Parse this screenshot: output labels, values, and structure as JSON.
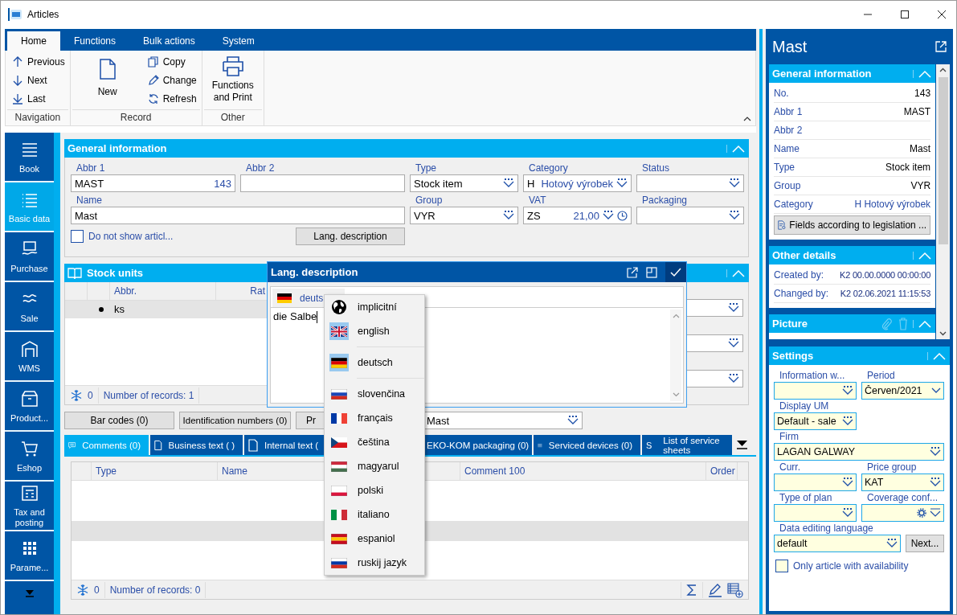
{
  "window": {
    "title": "Articles"
  },
  "ribbon": {
    "tabs": [
      {
        "label": "Home",
        "selected": true
      },
      {
        "label": "Functions",
        "selected": false
      },
      {
        "label": "Bulk actions",
        "selected": false
      },
      {
        "label": "System",
        "selected": false
      }
    ],
    "groups": [
      {
        "label": "Navigation",
        "buttons": [
          {
            "label": "Previous",
            "kind": "small"
          },
          {
            "label": "Next",
            "kind": "small"
          },
          {
            "label": "Last",
            "kind": "small"
          }
        ]
      },
      {
        "label": "Record",
        "buttons": [
          {
            "label": "New",
            "kind": "large"
          },
          {
            "label": "Copy",
            "kind": "small"
          },
          {
            "label": "Change",
            "kind": "small"
          },
          {
            "label": "Refresh",
            "kind": "small"
          }
        ]
      },
      {
        "label": "Other",
        "buttons": [
          {
            "label": "Functions and Print",
            "kind": "large"
          }
        ]
      }
    ]
  },
  "nav": [
    {
      "label": "Book",
      "selected": false
    },
    {
      "label": "Basic data",
      "selected": true
    },
    {
      "label": "Purchase",
      "selected": false
    },
    {
      "label": "Sale",
      "selected": false
    },
    {
      "label": "WMS",
      "selected": false
    },
    {
      "label": "Product...",
      "selected": false
    },
    {
      "label": "Eshop",
      "selected": false
    },
    {
      "label": "Tax and posting",
      "selected": false
    },
    {
      "label": "Parame...",
      "selected": false
    }
  ],
  "general": {
    "title": "General information",
    "fields": [
      {
        "label": "Abbr 1",
        "value": "MAST",
        "suffix": "143",
        "kind": "text"
      },
      {
        "label": "Abbr 2",
        "kind": "text"
      },
      {
        "label": "Type",
        "value": "Stock item",
        "kind": "lookup"
      },
      {
        "label": "Category",
        "value": "H",
        "suffix": "Hotový výrobek",
        "kind": "lookup"
      },
      {
        "label": "Status",
        "kind": "lookup"
      },
      {
        "label": "Name",
        "value": "Mast",
        "kind": "text"
      },
      {
        "label": "Group",
        "value": "VYR",
        "kind": "lookup"
      },
      {
        "label": "VAT",
        "value": "ZS",
        "suffix": "21,00",
        "kind": "lookup-clock"
      },
      {
        "label": "Packaging",
        "kind": "lookup"
      }
    ],
    "checkbox": {
      "label": "Do not show articl...",
      "checked": false
    },
    "button": "Lang. description"
  },
  "stock": {
    "title": "Stock units",
    "columns": [
      "Abbr.",
      "Rat"
    ],
    "rows": [
      {
        "current": true,
        "selected": true,
        "cells": [
          "ks"
        ]
      }
    ],
    "footer": {
      "count": "0",
      "records": "Number of records: 1"
    }
  },
  "actions": {
    "buttons": [
      "Bar codes (0)",
      "Identification numbers (0)",
      "Pr"
    ],
    "field": "Mast"
  },
  "tabs": [
    {
      "label": "Comments (0)",
      "selected": true
    },
    {
      "label": "Business text ( )",
      "selected": false
    },
    {
      "label": "Internal text (",
      "selected": false
    },
    {
      "label": "EKO-KOM packaging (0)",
      "selected": false
    },
    {
      "label": "Serviced devices (0)",
      "selected": false
    },
    {
      "label": "List of service sheets",
      "badge": "S",
      "selected": false
    }
  ],
  "comments": {
    "columns": [
      "Type",
      "Name",
      "Comment 100",
      "Order"
    ],
    "rows": [
      {
        "selected": false
      },
      {
        "selected": false
      },
      {
        "selected": true
      }
    ],
    "footer": {
      "count": "0",
      "records": "Number of records: 0"
    }
  },
  "popup": {
    "title": "Lang. description",
    "language": "deuts",
    "text": "die Salbe"
  },
  "language_menu": [
    {
      "label": "implicitní",
      "highlighted": false,
      "separator_after": false
    },
    {
      "label": "english",
      "highlighted": true,
      "separator_after": true
    },
    {
      "label": "deutsch",
      "highlighted": true,
      "separator_after": true
    },
    {
      "label": "slovenčina",
      "highlighted": false,
      "separator_after": false
    },
    {
      "label": "français",
      "highlighted": false,
      "separator_after": false
    },
    {
      "label": "čeština",
      "highlighted": false,
      "separator_after": false
    },
    {
      "label": "magyarul",
      "highlighted": false,
      "separator_after": false
    },
    {
      "label": "polski",
      "highlighted": false,
      "separator_after": false
    },
    {
      "label": "italiano",
      "highlighted": false,
      "separator_after": false
    },
    {
      "label": "espaniol",
      "highlighted": false,
      "separator_after": false
    },
    {
      "label": "ruskij jazyk",
      "highlighted": false,
      "separator_after": false
    }
  ],
  "side": {
    "title": "Mast",
    "general": {
      "title": "General information",
      "rows": [
        {
          "label": "No.",
          "value": "143",
          "linked": false
        },
        {
          "label": "Abbr 1",
          "value": "MAST",
          "linked": false
        },
        {
          "label": "Abbr 2"
        },
        {
          "label": "Name",
          "value": "Mast",
          "linked": false
        },
        {
          "label": "Type",
          "value": "Stock item",
          "linked": false
        },
        {
          "label": "Group",
          "value": "VYR",
          "linked": false
        },
        {
          "label": "Category",
          "value": "H Hotový výrobek",
          "linked": true
        }
      ],
      "button": "Fields according to legislation ..."
    },
    "other": {
      "title": "Other details",
      "rows": [
        {
          "label": "Created by:",
          "value": "K2 00.00.0000 00:00:00"
        },
        {
          "label": "Changed by:",
          "value": "K2 02.06.2021 11:15:53"
        }
      ]
    },
    "picture": {
      "title": "Picture"
    },
    "settings": {
      "title": "Settings",
      "rows": [
        [
          {
            "label": "Information w...",
            "kind": "lookup"
          },
          {
            "label": "Period",
            "value": "Červen/2021",
            "kind": "select"
          }
        ],
        [
          {
            "label": "Display UM",
            "value": "Default - sale",
            "kind": "lookup"
          }
        ],
        [
          {
            "label": "Firm",
            "value": "LAGAN GALWAY",
            "kind": "lookup"
          }
        ],
        [
          {
            "label": "Curr.",
            "kind": "lookup"
          },
          {
            "label": "Price group",
            "value": "KAT",
            "kind": "lookup"
          }
        ],
        [
          {
            "label": "Type of plan",
            "kind": "lookup"
          },
          {
            "label": "Coverage conf...",
            "kind": "gear"
          }
        ],
        [
          {
            "label": "Data editing language",
            "value": "default",
            "kind": "lookup",
            "button": "Next..."
          }
        ]
      ],
      "checkbox": {
        "label": "Only article with availability",
        "checked": false
      }
    }
  }
}
